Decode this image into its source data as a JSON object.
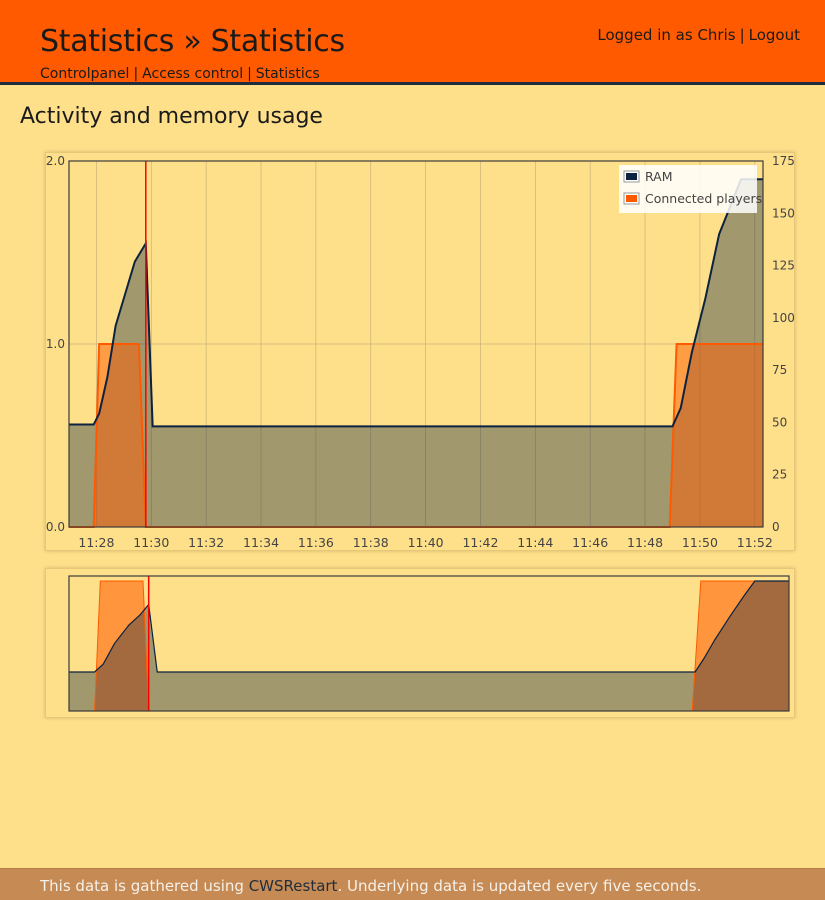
{
  "header": {
    "title": "Statistics » Statistics",
    "breadcrumb": [
      {
        "label": "Controlpanel"
      },
      {
        "label": "Access control"
      },
      {
        "label": "Statistics"
      }
    ],
    "breadcrumb_separator": "|",
    "user": {
      "logged_in_text": "Logged in as Chris",
      "separator": "|",
      "logout_label": "Logout"
    }
  },
  "main": {
    "heading": "Activity and memory usage"
  },
  "footer": {
    "prefix": "This data is gathered using ",
    "link_label": "CWSRestart",
    "suffix": ". Underlying data is updated every five seconds."
  },
  "colors": {
    "header_bg": "#ff5a00",
    "page_bg": "#ffe08a",
    "footer_bg": "#c68a54",
    "ram": "#0b2240",
    "players": "#ff5a00",
    "cursor": "#ff0000"
  },
  "chart_data": [
    {
      "type": "area",
      "x_unit": "time",
      "x_ticks": [
        "11:28",
        "11:30",
        "11:32",
        "11:34",
        "11:36",
        "11:38",
        "11:40",
        "11:42",
        "11:44",
        "11:46",
        "11:48",
        "11:50",
        "11:52"
      ],
      "y_left": {
        "ticks": [
          "0.0",
          "1.0",
          "2.0"
        ],
        "range": [
          0,
          2
        ]
      },
      "y_right": {
        "ticks": [
          "0",
          "25",
          "50",
          "75",
          "100",
          "125",
          "150",
          "175"
        ],
        "range": [
          0,
          175
        ]
      },
      "legend": {
        "position": "top-right",
        "entries": [
          "RAM",
          "Connected players"
        ]
      },
      "grid": true,
      "cursor_time": "11:29.8",
      "series": [
        {
          "name": "RAM",
          "axis": "left",
          "color": "#0b2240",
          "x": [
            27.0,
            27.9,
            28.1,
            28.4,
            28.7,
            29.1,
            29.4,
            29.8,
            30.05,
            49.0,
            49.3,
            49.7,
            50.2,
            50.7,
            51.1,
            51.5,
            52.3
          ],
          "y": [
            0.56,
            0.56,
            0.62,
            0.82,
            1.1,
            1.3,
            1.45,
            1.55,
            0.55,
            0.55,
            0.65,
            0.95,
            1.25,
            1.6,
            1.75,
            1.9,
            1.9
          ]
        },
        {
          "name": "Connected players",
          "axis": "left",
          "color": "#ff5a00",
          "x": [
            27.0,
            27.9,
            28.1,
            29.55,
            29.8,
            48.9,
            49.15,
            52.3
          ],
          "y": [
            0.0,
            0.0,
            1.0,
            1.0,
            0.0,
            0.0,
            1.0,
            1.0
          ]
        }
      ]
    },
    {
      "type": "area",
      "role": "overview",
      "series": [
        {
          "name": "RAM",
          "color": "#0b2240",
          "x": [
            27.0,
            27.9,
            28.2,
            28.6,
            29.1,
            29.5,
            29.8,
            30.1,
            49.0,
            49.3,
            49.7,
            50.2,
            50.7,
            51.1,
            51.5,
            52.3
          ],
          "y": [
            0.3,
            0.3,
            0.36,
            0.52,
            0.66,
            0.74,
            0.82,
            0.3,
            0.3,
            0.4,
            0.55,
            0.72,
            0.88,
            1.0,
            1.0,
            1.0
          ]
        },
        {
          "name": "Connected players",
          "color": "#ff5a00",
          "x": [
            27.0,
            27.9,
            28.1,
            29.6,
            29.8,
            48.9,
            49.2,
            52.3
          ],
          "y": [
            0.0,
            0.0,
            1.0,
            1.0,
            0.0,
            0.0,
            1.0,
            1.0
          ]
        }
      ]
    }
  ]
}
